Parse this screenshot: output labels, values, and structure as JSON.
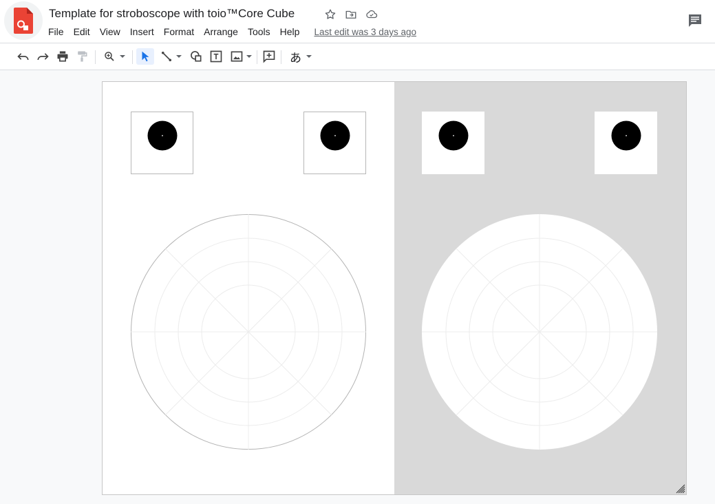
{
  "header": {
    "title": "Template for stroboscope with toio™Core Cube",
    "last_edit": "Last edit was 3 days ago"
  },
  "menu": {
    "items": [
      "File",
      "Edit",
      "View",
      "Insert",
      "Format",
      "Arrange",
      "Tools",
      "Help"
    ]
  },
  "toolbar": {
    "input_tool_label": "あ"
  },
  "colors": {
    "app_icon": "#ea4335",
    "selected_tool": "#1a73e8",
    "grey_panel": "#d9d9d9",
    "marker": "#000000"
  },
  "icons": [
    "drawings-logo-icon",
    "star-icon",
    "move-to-folder-icon",
    "cloud-status-icon",
    "comment-icon",
    "undo-icon",
    "redo-icon",
    "print-icon",
    "paint-format-icon",
    "zoom-icon",
    "select-icon",
    "line-icon",
    "shape-icon",
    "text-box-icon",
    "image-icon",
    "add-comment-icon",
    "input-tools-icon"
  ]
}
